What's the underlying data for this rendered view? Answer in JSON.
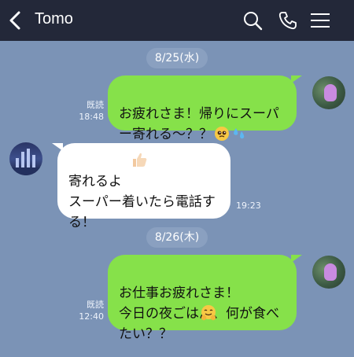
{
  "header": {
    "contact_name": "Tomo"
  },
  "icons": {
    "back": "chevron-left-icon",
    "search": "search-icon",
    "call": "phone-icon",
    "menu": "hamburger-menu-icon"
  },
  "colors": {
    "header_bg": "#232839",
    "chat_bg": "#7b93b6",
    "sent_bubble": "#86e14a",
    "recv_bubble": "#ffffff"
  },
  "messages": [
    {
      "date": "8/25(水)"
    },
    {
      "sender": "me",
      "text": "お疲れさま！帰りにスーパー寄れる〜？？",
      "emoji": [
        "pleading-face",
        "sweat-droplets"
      ],
      "read": "既読",
      "time": "18:48"
    },
    {
      "sender": "Tomo",
      "text": "寄れるよ\nスーパー着いたら電話する！",
      "emoji": [
        "thumbs-up"
      ],
      "time": "19:23"
    },
    {
      "date": "8/26(木)"
    },
    {
      "sender": "me",
      "text": "お仕事お疲れさま！\n今日の夜ごはん、何が食べたい？？",
      "emoji": [
        "hugging-face"
      ],
      "read": "既読",
      "time": "12:40"
    }
  ]
}
